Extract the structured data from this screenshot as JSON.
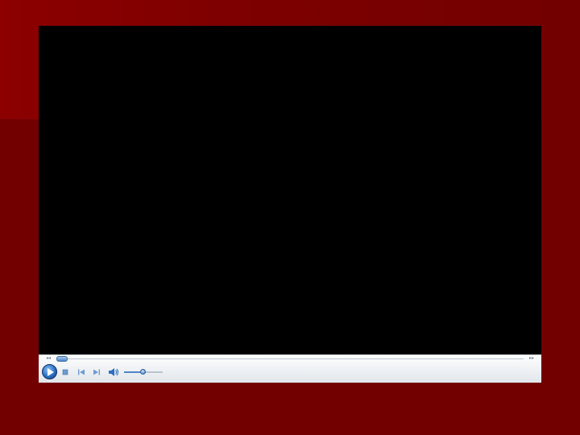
{
  "player": {
    "seek_position": 0.0,
    "volume_level": 0.52,
    "icons": {
      "play": "play-icon",
      "stop": "stop-icon",
      "previous": "previous-track-icon",
      "next": "next-track-icon",
      "volume": "speaker-icon",
      "seek_back": "seek-back-icon",
      "seek_forward": "seek-forward-icon"
    }
  },
  "colors": {
    "background": "#720000",
    "background_highlight": "#8c0000",
    "video_area": "#000000",
    "control_bar": "#eef1f4",
    "accent_blue": "#2b6fc2"
  }
}
